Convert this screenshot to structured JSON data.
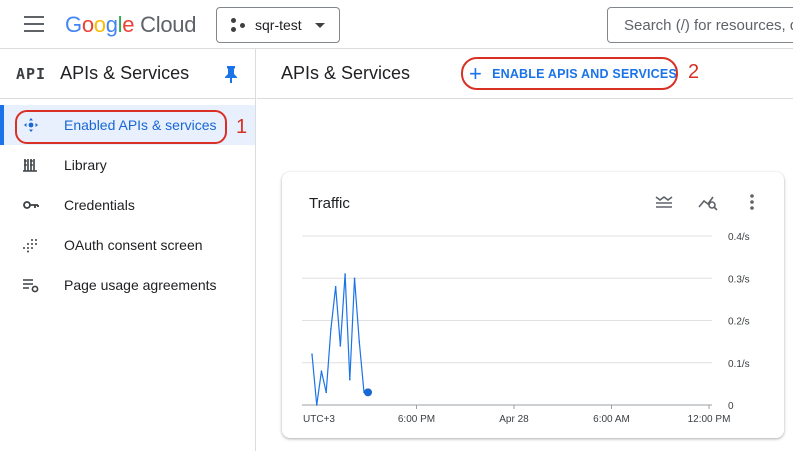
{
  "topbar": {
    "logo_google": "Google",
    "logo_cloud": "Cloud",
    "project_name": "sqr-test",
    "search_placeholder": "Search (/) for resources, docs, products, and more"
  },
  "sidebar": {
    "api_mark": "API",
    "title": "APIs & Services",
    "items": [
      {
        "label": "Enabled APIs & services",
        "icon": "diamond-dots-icon",
        "active": true
      },
      {
        "label": "Library",
        "icon": "library-icon",
        "active": false
      },
      {
        "label": "Credentials",
        "icon": "key-icon",
        "active": false
      },
      {
        "label": "OAuth consent screen",
        "icon": "dotted-grid-icon",
        "active": false
      },
      {
        "label": "Page usage agreements",
        "icon": "settings-list-icon",
        "active": false
      }
    ]
  },
  "main": {
    "title": "APIs & Services",
    "enable_button_label": "ENABLE APIS AND SERVICES"
  },
  "annotations": {
    "one": "1",
    "two": "2"
  },
  "colors": {
    "accent": "#1a73e8",
    "annotation": "#d93025",
    "series": "#1a73e8"
  },
  "chart_data": {
    "type": "line",
    "title": "Traffic",
    "x_tick_labels": [
      "UTC+3",
      "6:00 PM",
      "Apr 28",
      "6:00 AM",
      "12:00 PM"
    ],
    "y_tick_labels": [
      "0",
      "0.1/s",
      "0.2/s",
      "0.3/s",
      "0.4/s"
    ],
    "ylim": [
      0,
      0.4
    ],
    "grid": true,
    "series": [
      {
        "values": [
          0.12,
          0.0,
          0.08,
          0.03,
          0.18,
          0.28,
          0.14,
          0.31,
          0.06,
          0.3,
          0.15,
          0.03
        ]
      }
    ]
  }
}
